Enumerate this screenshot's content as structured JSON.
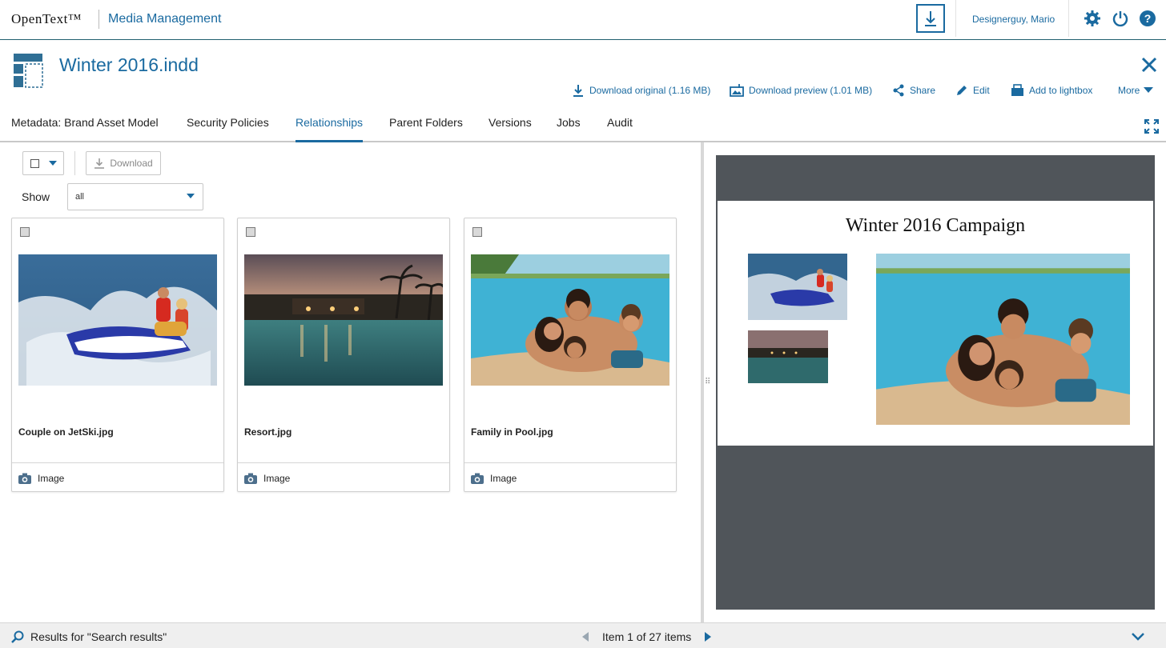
{
  "topbar": {
    "brand": "OpenText™",
    "app_name": "Media Management",
    "user_name": "Designerguy, Mario",
    "icons": [
      "download-icon",
      "settings-gear-icon",
      "power-icon",
      "help-icon"
    ]
  },
  "asset": {
    "title": "Winter 2016.indd",
    "icon": "layout-document-icon",
    "actions": [
      {
        "label": "Download original (1.16 MB)",
        "icon": "download-icon"
      },
      {
        "label": "Download preview (1.01 MB)",
        "icon": "download-preview-icon"
      },
      {
        "label": "Share",
        "icon": "share-icon"
      },
      {
        "label": "Edit",
        "icon": "pencil-icon"
      },
      {
        "label": "Add to lightbox",
        "icon": "lightbox-icon"
      },
      {
        "label": "More",
        "icon": "caret-down-icon"
      }
    ]
  },
  "tabs": [
    {
      "label": "Metadata: Brand Asset Model",
      "active": false
    },
    {
      "label": "Security Policies",
      "active": false
    },
    {
      "label": "Relationships",
      "active": true
    },
    {
      "label": "Parent Folders",
      "active": false
    },
    {
      "label": "Versions",
      "active": false
    },
    {
      "label": "Jobs",
      "active": false
    },
    {
      "label": "Audit",
      "active": false
    }
  ],
  "toolbar": {
    "download_label": "Download",
    "show_label": "Show",
    "show_value": "all"
  },
  "cards": [
    {
      "name": "Couple on JetSki.jpg",
      "type": "Image"
    },
    {
      "name": "Resort.jpg",
      "type": "Image"
    },
    {
      "name": "Family in Pool.jpg",
      "type": "Image"
    }
  ],
  "preview": {
    "title": "Winter 2016 Campaign"
  },
  "statusbar": {
    "results_text": "Results for \"Search results\"",
    "pager_text": "Item 1 of 27 items"
  },
  "colors": {
    "accent": "#1a6aa0",
    "preview_bg": "#50555a",
    "status_bg": "#efefef"
  }
}
